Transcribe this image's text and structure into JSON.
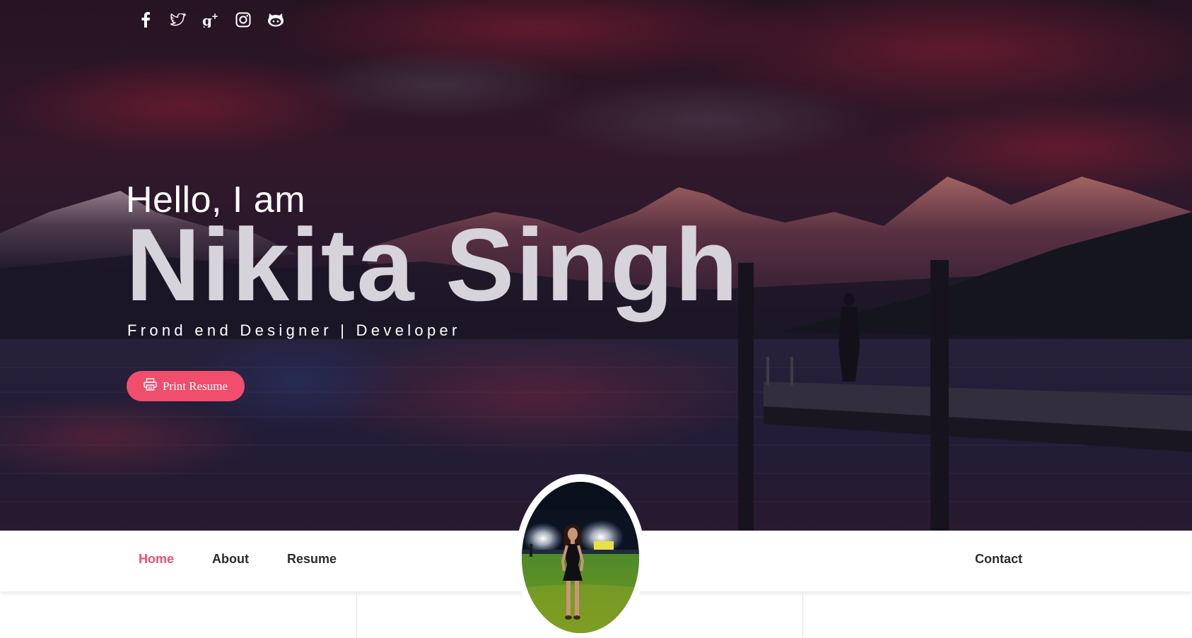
{
  "hero": {
    "greeting": "Hello, I am",
    "name": "Nikita Singh",
    "tagline": "Frond end Designer | Developer",
    "print_button_label": "Print Resume"
  },
  "social": [
    {
      "icon": "facebook-icon"
    },
    {
      "icon": "twitter-icon"
    },
    {
      "icon": "google-plus-icon"
    },
    {
      "icon": "instagram-icon"
    },
    {
      "icon": "github-icon"
    }
  ],
  "nav": {
    "items": [
      {
        "label": "Home",
        "active": true
      },
      {
        "label": "About",
        "active": false
      },
      {
        "label": "Resume",
        "active": false
      },
      {
        "label": "Contact",
        "active": false
      }
    ]
  },
  "colors": {
    "accent": "#f04e6c",
    "nav_text": "#2b2b2b",
    "hero_name": "#d6d3da"
  }
}
